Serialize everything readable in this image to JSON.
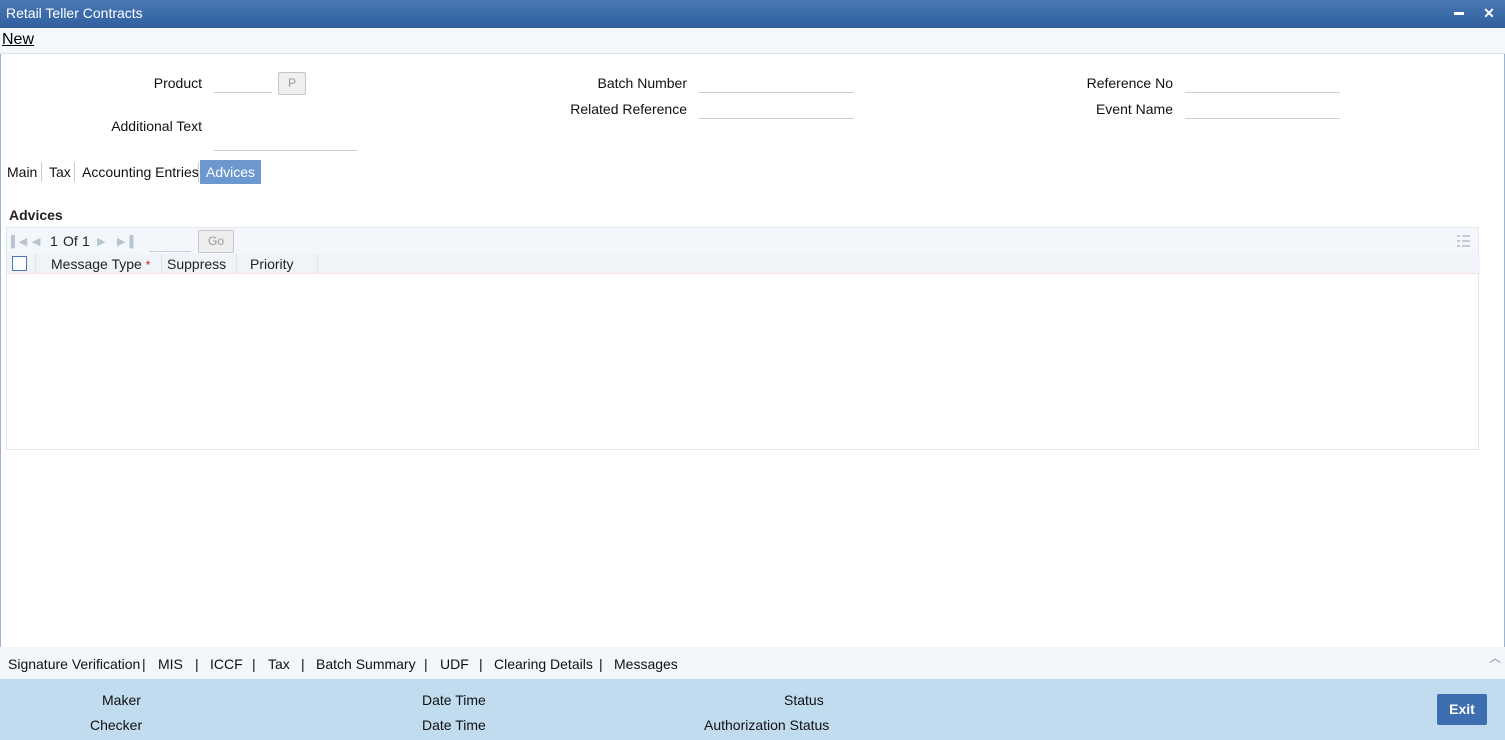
{
  "window": {
    "title": "Retail Teller Contracts",
    "minimize_glyph": "▬",
    "close_glyph": "✕"
  },
  "toolbar": {
    "new_label": "New"
  },
  "form": {
    "product_label": "Product",
    "product_button": "P",
    "additional_text_label": "Additional Text",
    "batch_number_label": "Batch Number",
    "related_reference_label": "Related Reference",
    "reference_no_label": "Reference No",
    "event_name_label": "Event Name"
  },
  "tabs": [
    {
      "label": "Main"
    },
    {
      "label": "Tax"
    },
    {
      "label": "Accounting Entries"
    },
    {
      "label": "Advices",
      "active": true
    }
  ],
  "advices": {
    "section_title": "Advices",
    "pager": {
      "current": "1",
      "of_label": "Of",
      "total": "1",
      "go_label": "Go"
    },
    "columns": {
      "message_type": "Message Type",
      "required_mark": "*",
      "suppress": "Suppress",
      "priority": "Priority"
    },
    "rows": []
  },
  "bottom_links": [
    "Signature Verification",
    "MIS",
    "ICCF",
    "Tax",
    "Batch Summary",
    "UDF",
    "Clearing Details",
    "Messages"
  ],
  "footer": {
    "maker_label": "Maker",
    "checker_label": "Checker",
    "date_time_label_1": "Date Time",
    "date_time_label_2": "Date Time",
    "status_label": "Status",
    "authorization_status_label": "Authorization Status",
    "exit_label": "Exit"
  },
  "colors": {
    "titlebar": "#3a6aab",
    "active_tab": "#6d98cf",
    "footer": "#c1dbef",
    "exit_button": "#3d6eaf"
  }
}
